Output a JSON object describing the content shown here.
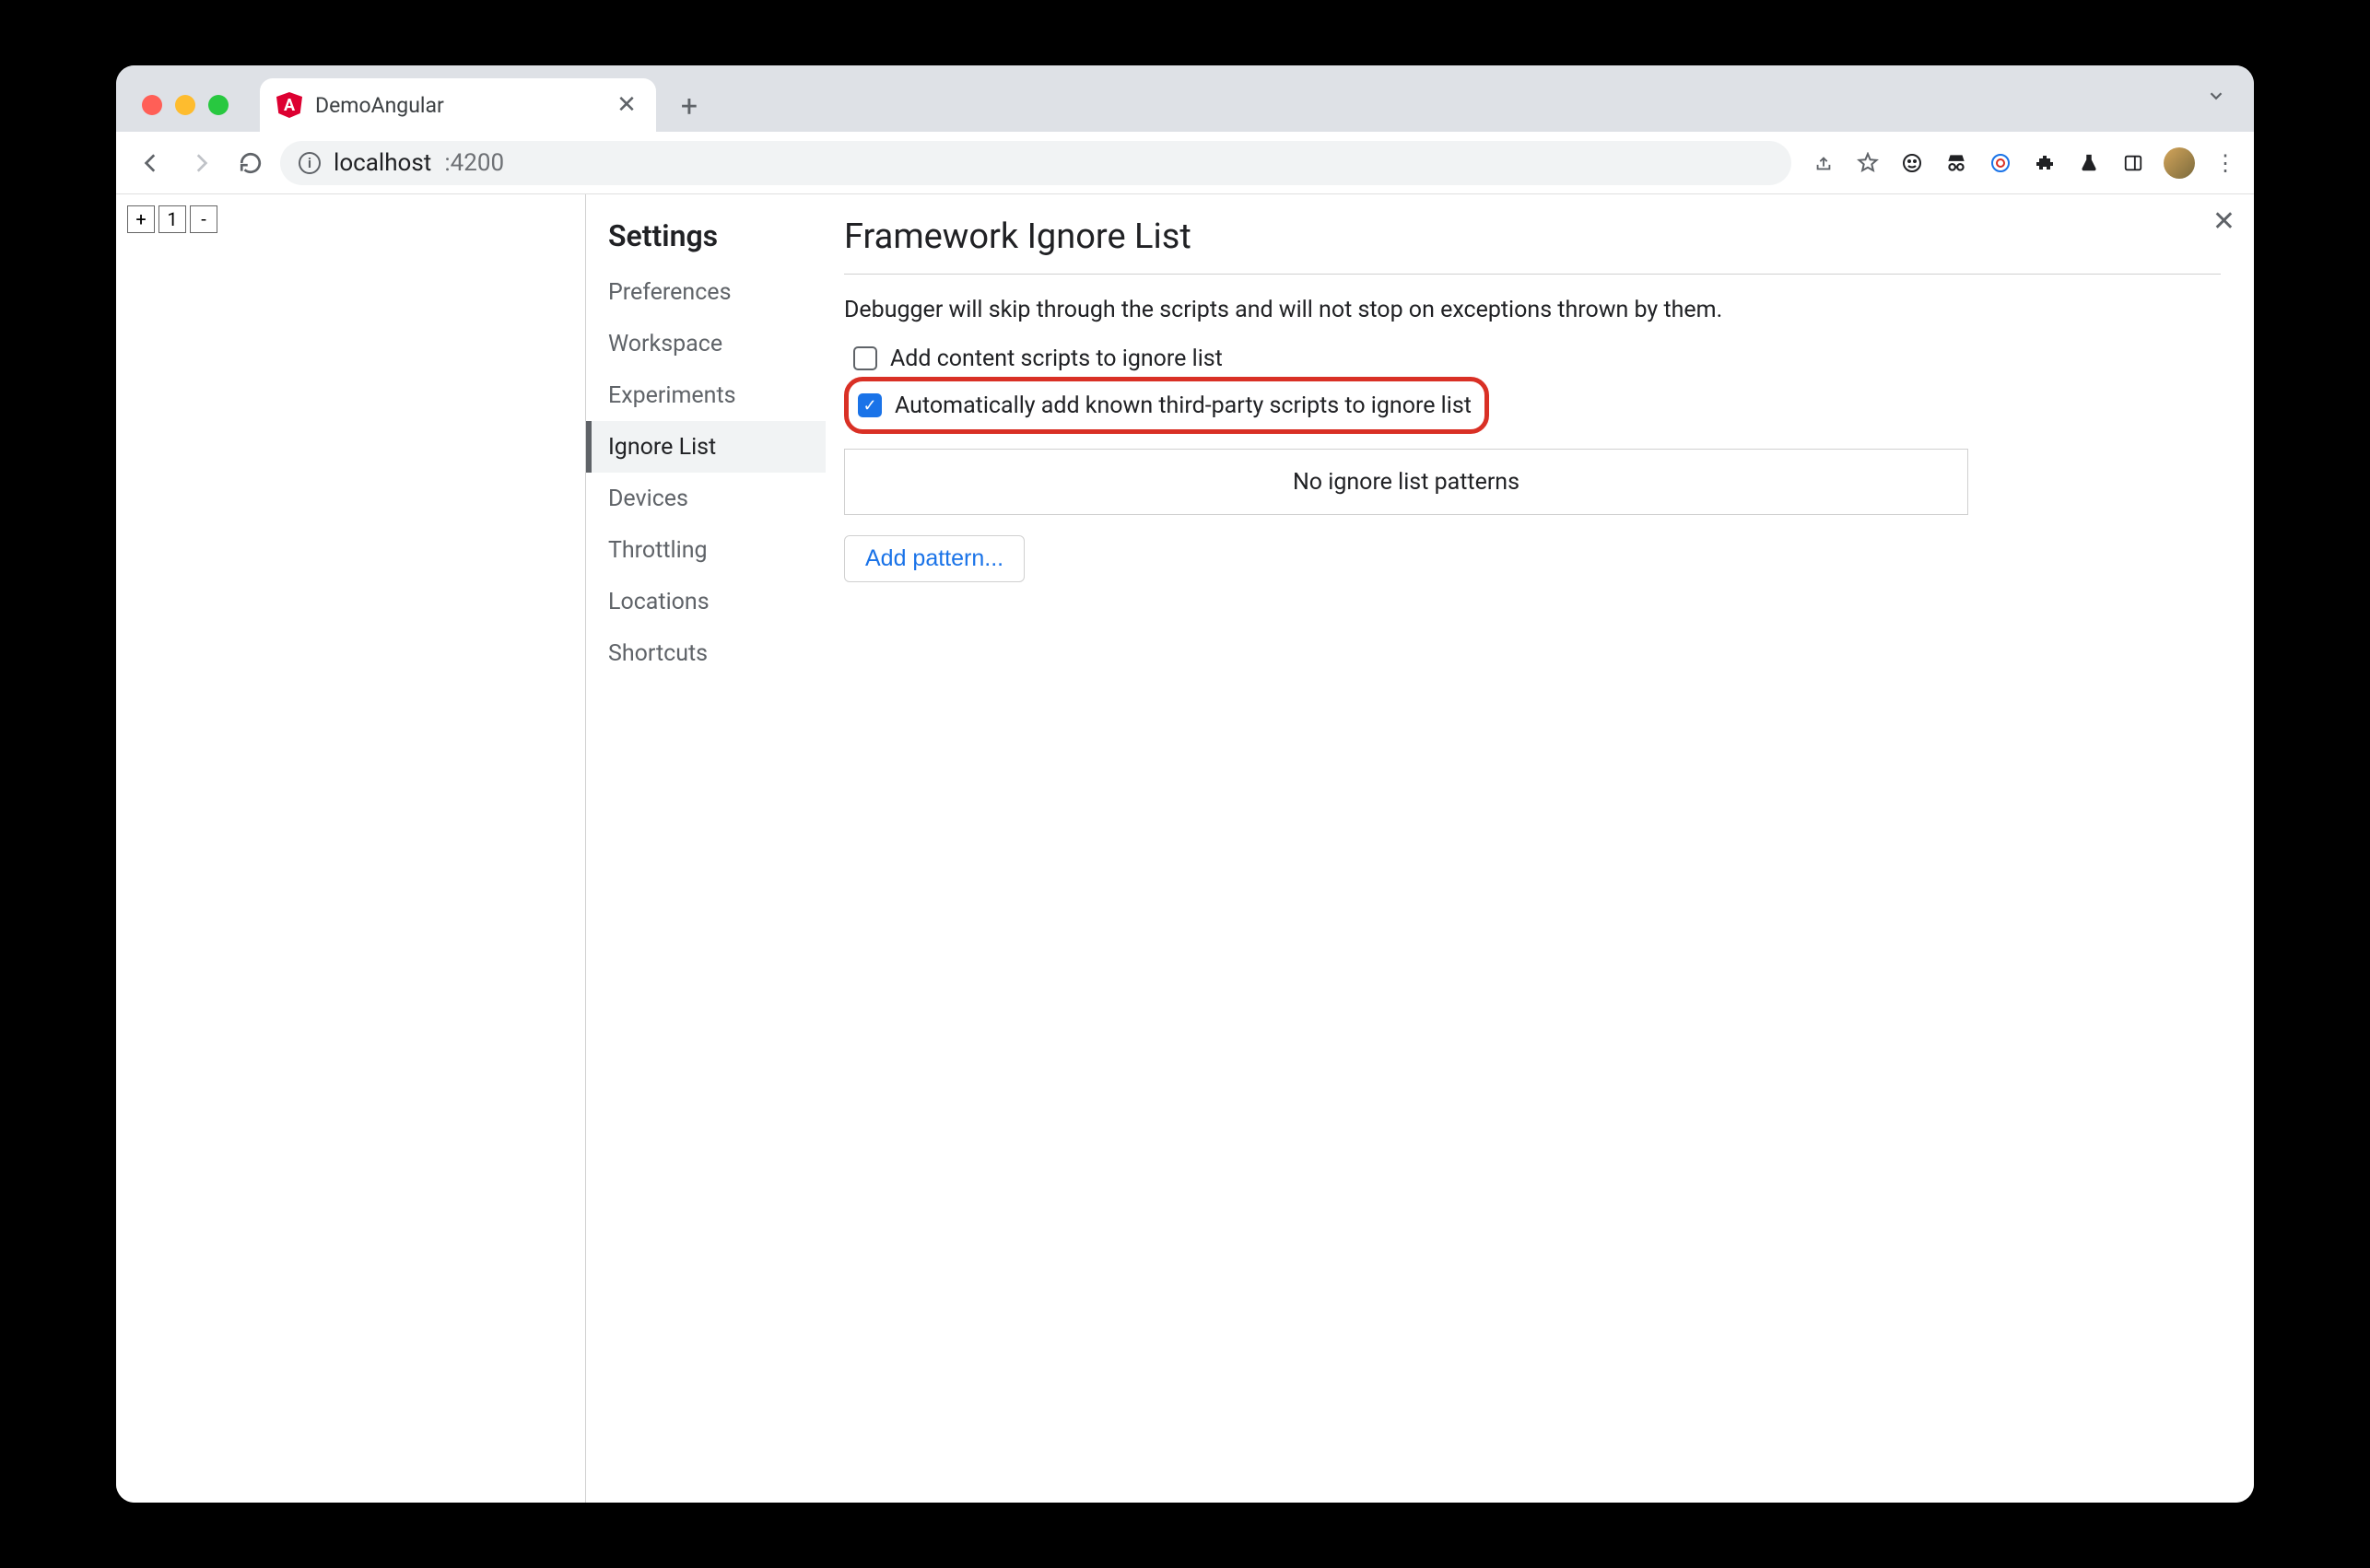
{
  "tab": {
    "title": "DemoAngular"
  },
  "url": {
    "host": "localhost",
    "port": ":4200"
  },
  "page": {
    "counter": {
      "plus": "+",
      "value": "1",
      "minus": "-"
    }
  },
  "settings": {
    "title": "Settings",
    "nav": [
      "Preferences",
      "Workspace",
      "Experiments",
      "Ignore List",
      "Devices",
      "Throttling",
      "Locations",
      "Shortcuts"
    ],
    "active_index": 3,
    "panel": {
      "heading": "Framework Ignore List",
      "description": "Debugger will skip through the scripts and will not stop on exceptions thrown by them.",
      "checkbox1": {
        "label": "Add content scripts to ignore list",
        "checked": false
      },
      "checkbox2": {
        "label": "Automatically add known third-party scripts to ignore list",
        "checked": true
      },
      "empty_patterns": "No ignore list patterns",
      "add_button": "Add pattern..."
    }
  }
}
